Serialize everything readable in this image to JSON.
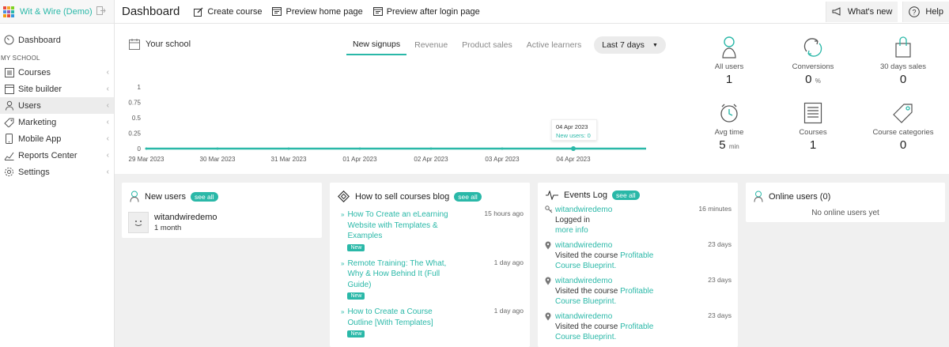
{
  "brand": {
    "name": "Wit & Wire (Demo)"
  },
  "sidebar": {
    "dashboard": "Dashboard",
    "section": "MY SCHOOL",
    "items": [
      {
        "label": "Courses",
        "icon": "courses-icon"
      },
      {
        "label": "Site builder",
        "icon": "site-builder-icon"
      },
      {
        "label": "Users",
        "icon": "users-icon"
      },
      {
        "label": "Marketing",
        "icon": "marketing-icon"
      },
      {
        "label": "Mobile App",
        "icon": "mobile-icon"
      },
      {
        "label": "Reports Center",
        "icon": "reports-icon"
      },
      {
        "label": "Settings",
        "icon": "settings-icon"
      }
    ]
  },
  "topbar": {
    "title": "Dashboard",
    "create_course": "Create course",
    "preview_home": "Preview home page",
    "preview_after_login": "Preview after login page",
    "whats_new": "What's new",
    "help": "Help"
  },
  "overview": {
    "title": "Your school",
    "tabs": [
      "New signups",
      "Revenue",
      "Product sales",
      "Active learners"
    ],
    "active_tab": "New signups",
    "period": "Last 7 days",
    "tooltip": {
      "date": "04 Apr 2023",
      "label": "New users: 0"
    }
  },
  "chart_data": {
    "type": "line",
    "x": [
      "29 Mar 2023",
      "30 Mar 2023",
      "31 Mar 2023",
      "01 Apr 2023",
      "02 Apr 2023",
      "03 Apr 2023",
      "04 Apr 2023"
    ],
    "series": [
      {
        "values": [
          0,
          0,
          0,
          0,
          0,
          0,
          0
        ]
      }
    ],
    "yticks": [
      "1",
      "0.75",
      "0.5",
      "0.25",
      "0"
    ],
    "ylim": [
      0,
      1
    ],
    "grid": false,
    "color": "#2ab8a8"
  },
  "stats": [
    {
      "label": "All users",
      "value": "1",
      "unit": "",
      "icon": "user-icon"
    },
    {
      "label": "Conversions",
      "value": "0",
      "unit": "%",
      "icon": "conversion-icon"
    },
    {
      "label": "30 days sales",
      "value": "0",
      "unit": "",
      "icon": "shopping-bag-icon"
    },
    {
      "label": "Avg time",
      "value": "5",
      "unit": "min",
      "icon": "clock-icon"
    },
    {
      "label": "Courses",
      "value": "1",
      "unit": "",
      "icon": "courses-list-icon"
    },
    {
      "label": "Course categories",
      "value": "0",
      "unit": "",
      "icon": "tag-icon"
    }
  ],
  "new_users": {
    "title": "New users",
    "see_all": "see all",
    "users": [
      {
        "name": "witandwiredemo",
        "time": "1 month"
      }
    ]
  },
  "blog": {
    "title": "How to sell courses blog",
    "see_all": "see all",
    "posts": [
      {
        "lines": [
          "How To Create an eLearning",
          "Website with Templates &",
          "Examples"
        ],
        "time": "15 hours ago",
        "tag": "New"
      },
      {
        "lines": [
          "Remote Training: The What,",
          "Why & How Behind It (Full",
          "Guide)"
        ],
        "time": "1 day ago",
        "tag": "New"
      },
      {
        "lines": [
          "How to Create a Course",
          "Outline [With Templates]"
        ],
        "time": "1 day ago",
        "tag": "New"
      }
    ]
  },
  "events": {
    "title": "Events Log",
    "see_all": "see all",
    "items": [
      {
        "user": "witandwiredemo",
        "line1": "Logged in",
        "link": "more info",
        "time": "16 minutes",
        "icon": "key-icon"
      },
      {
        "user": "witandwiredemo",
        "text": "Visited the course",
        "course1": "Profitable",
        "course2": "Course Blueprint.",
        "time": "23 days",
        "icon": "location-pin-icon"
      },
      {
        "user": "witandwiredemo",
        "text": "Visited the course",
        "course1": "Profitable",
        "course2": "Course Blueprint.",
        "time": "23 days",
        "icon": "location-pin-icon"
      },
      {
        "user": "witandwiredemo",
        "text": "Visited the course",
        "course1": "Profitable",
        "course2": "Course Blueprint.",
        "time": "23 days",
        "icon": "location-pin-icon"
      }
    ]
  },
  "online": {
    "title": "Online users (0)",
    "empty": "No online users yet"
  },
  "colors": {
    "accent": "#2ab8a8"
  }
}
